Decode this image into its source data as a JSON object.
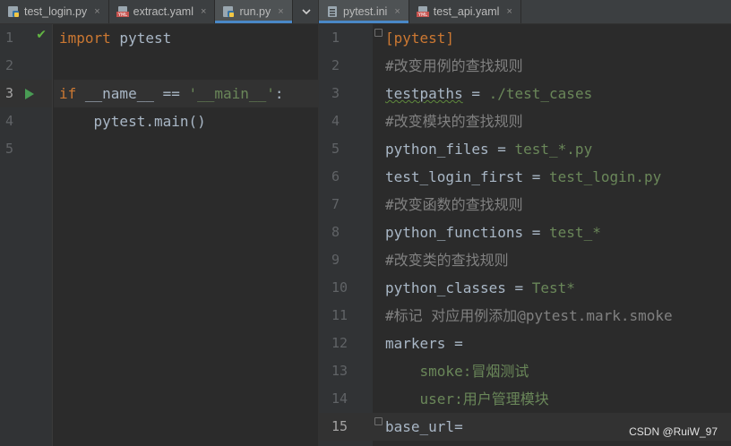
{
  "left_tabs": [
    {
      "label": "test_login.py",
      "icon": "python-file-icon",
      "active": false
    },
    {
      "label": "extract.yaml",
      "icon": "yaml-file-icon",
      "active": false
    },
    {
      "label": "run.py",
      "icon": "python-file-icon",
      "active": true
    }
  ],
  "right_tabs": [
    {
      "label": "pytest.ini",
      "icon": "ini-file-icon",
      "active": true
    },
    {
      "label": "test_api.yaml",
      "icon": "yaml-file-icon",
      "active": false
    }
  ],
  "tab_menu_icon": "chevron-down-icon",
  "close_glyph": "×",
  "left_editor": {
    "file": "run.py",
    "current_line": 3,
    "line_numbers": [
      "1",
      "2",
      "3",
      "4",
      "5"
    ],
    "lines": [
      [
        {
          "t": "import",
          "c": "kw"
        },
        {
          "t": " pytest",
          "c": "plain"
        }
      ],
      [],
      [
        {
          "t": "if",
          "c": "kw"
        },
        {
          "t": " __name__ == ",
          "c": "plain"
        },
        {
          "t": "'__main__'",
          "c": "str"
        },
        {
          "t": ":",
          "c": "plain"
        }
      ],
      [
        {
          "t": "    pytest.main()",
          "c": "plain"
        }
      ],
      []
    ]
  },
  "right_editor": {
    "file": "pytest.ini",
    "current_line": 15,
    "line_numbers": [
      "1",
      "2",
      "3",
      "4",
      "5",
      "6",
      "7",
      "8",
      "9",
      "10",
      "11",
      "12",
      "13",
      "14",
      "15"
    ],
    "lines": [
      [
        {
          "t": "[pytest]",
          "c": "sect"
        }
      ],
      [
        {
          "t": "#改变用例的查找规则",
          "c": "comment"
        }
      ],
      [
        {
          "t": "testpaths",
          "c": "key typo"
        },
        {
          "t": " = ",
          "c": "plain"
        },
        {
          "t": "./test_cases",
          "c": "val"
        }
      ],
      [
        {
          "t": "#改变模块的查找规则",
          "c": "comment"
        }
      ],
      [
        {
          "t": "python_files",
          "c": "key"
        },
        {
          "t": " = ",
          "c": "plain"
        },
        {
          "t": "test_*.py",
          "c": "val"
        }
      ],
      [
        {
          "t": "test_login_first",
          "c": "key"
        },
        {
          "t": " = ",
          "c": "plain"
        },
        {
          "t": "test_login.py",
          "c": "val"
        }
      ],
      [
        {
          "t": "#改变函数的查找规则",
          "c": "comment"
        }
      ],
      [
        {
          "t": "python_functions",
          "c": "key"
        },
        {
          "t": " = ",
          "c": "plain"
        },
        {
          "t": "test_*",
          "c": "val"
        }
      ],
      [
        {
          "t": "#改变类的查找规则",
          "c": "comment"
        }
      ],
      [
        {
          "t": "python_classes",
          "c": "key"
        },
        {
          "t": " = ",
          "c": "plain"
        },
        {
          "t": "Test*",
          "c": "val"
        }
      ],
      [
        {
          "t": "#标记 对应用例添加@pytest.mark.smoke",
          "c": "comment"
        }
      ],
      [
        {
          "t": "markers",
          "c": "key"
        },
        {
          "t": " =",
          "c": "plain"
        }
      ],
      [
        {
          "t": "    smoke:冒烟测试",
          "c": "val"
        }
      ],
      [
        {
          "t": "    user:用户管理模块",
          "c": "val"
        }
      ],
      [
        {
          "t": "base_url",
          "c": "key"
        },
        {
          "t": "=",
          "c": "plain"
        }
      ]
    ]
  },
  "watermark": "CSDN @RuiW_97"
}
